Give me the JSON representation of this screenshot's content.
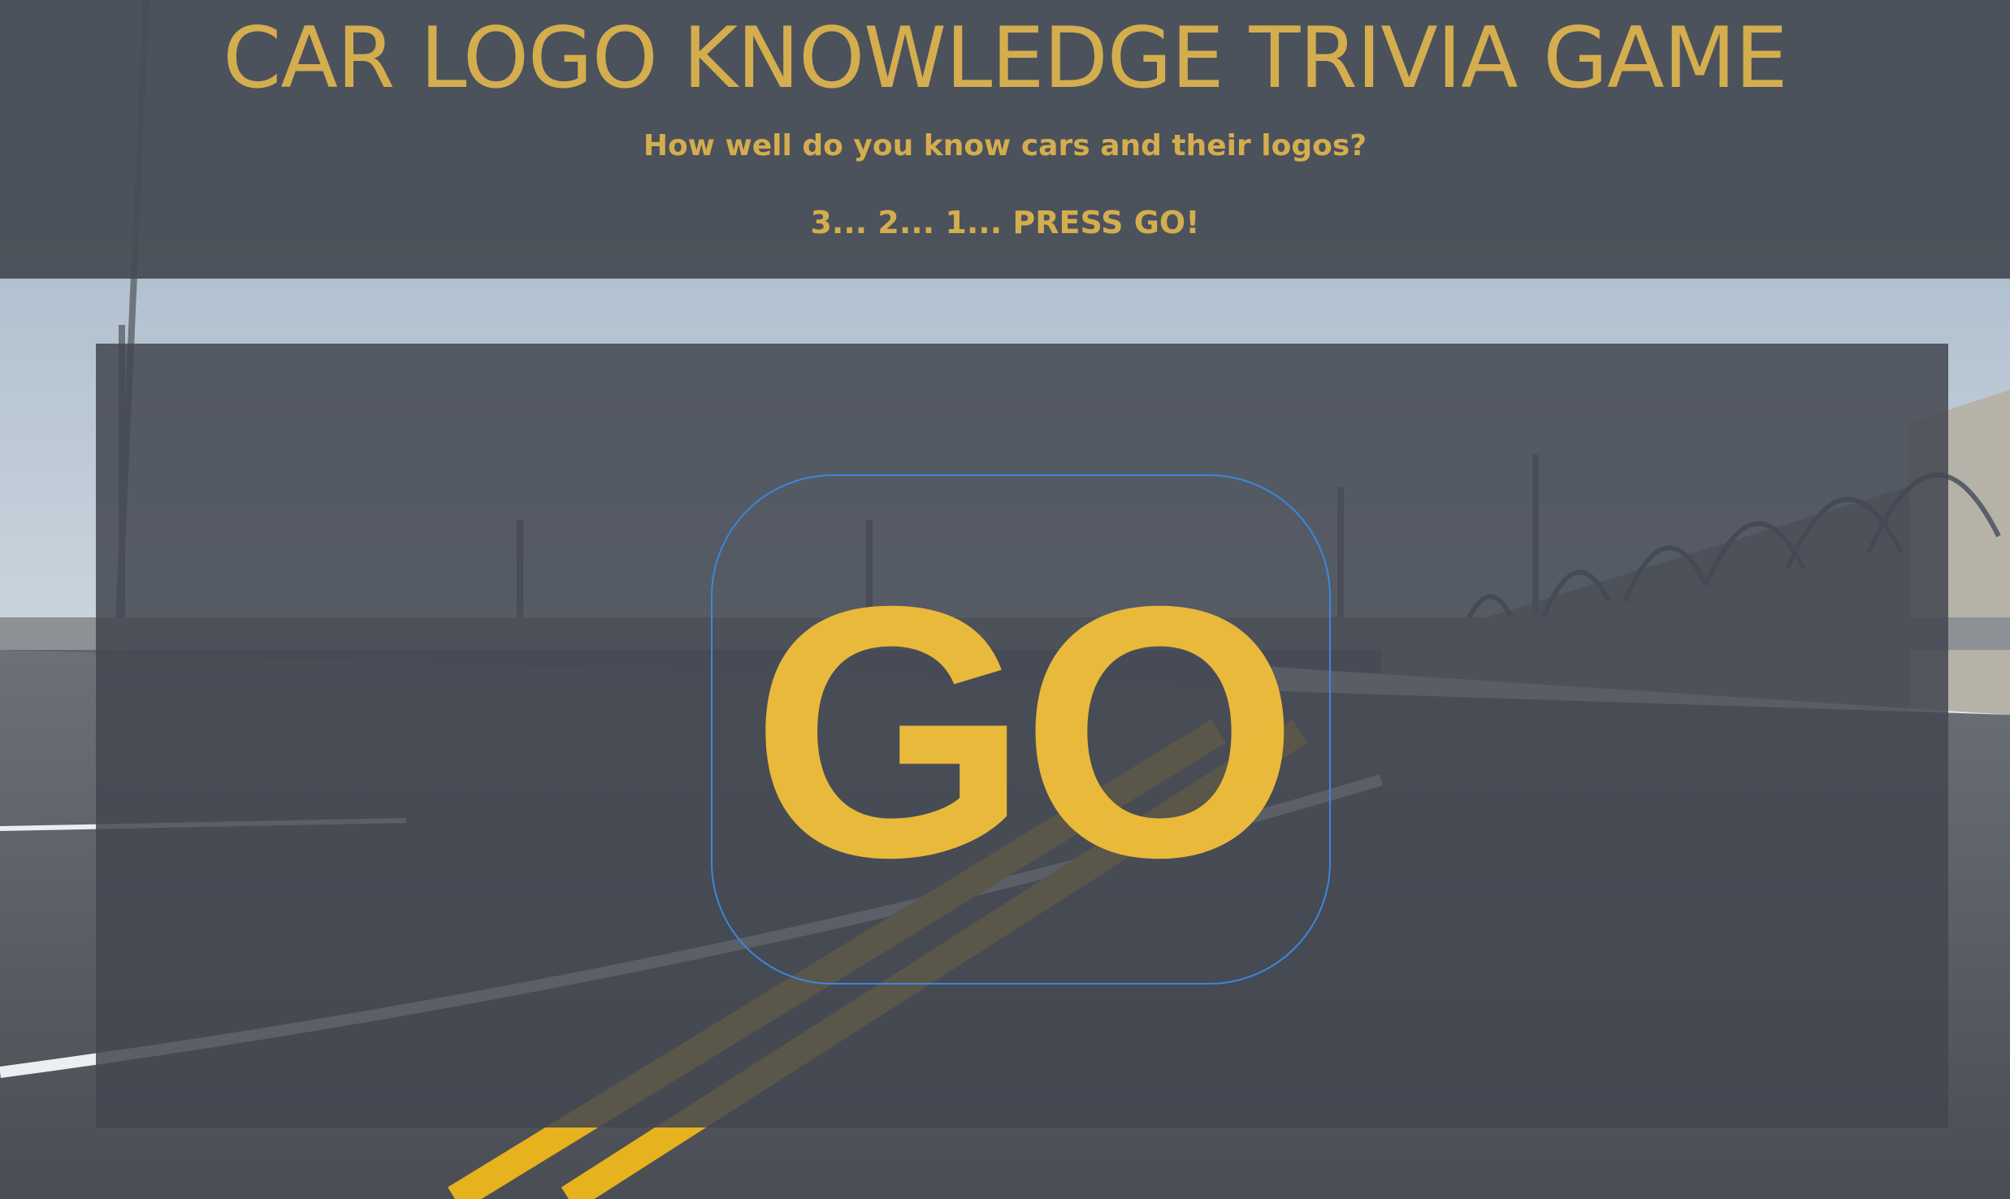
{
  "header": {
    "title": "CAR LOGO KNOWLEDGE TRIVIA GAME",
    "subtitle": "How well do you know cars and their logos?",
    "countdown": "3... 2... 1... PRESS GO!"
  },
  "game": {
    "go_label": "GO"
  },
  "colors": {
    "accent_gold": "#d4ad4f",
    "go_yellow": "#f2bf3a",
    "button_outline": "#3d86de",
    "overlay": "#464b54"
  },
  "background": {
    "icon": "race-track-image"
  }
}
